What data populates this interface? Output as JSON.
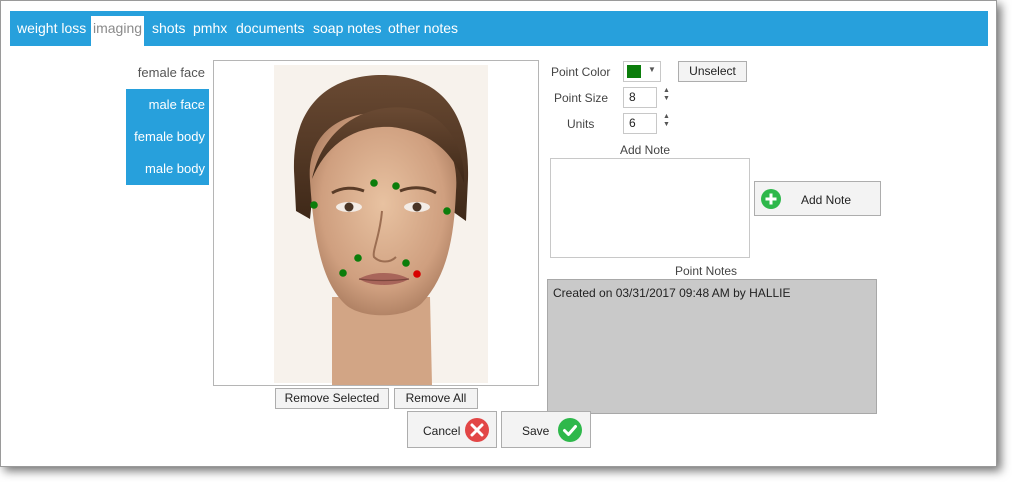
{
  "tabs": [
    {
      "label": "weight loss"
    },
    {
      "label": "imaging"
    },
    {
      "label": "shots"
    },
    {
      "label": "pmhx"
    },
    {
      "label": "documents"
    },
    {
      "label": "soap notes"
    },
    {
      "label": "other notes"
    }
  ],
  "active_tab": "imaging",
  "nav": {
    "items": [
      {
        "label": "female face"
      },
      {
        "label": "male face"
      },
      {
        "label": "female body"
      },
      {
        "label": "male body"
      }
    ]
  },
  "image": {
    "subject": "female face illustration",
    "point_colors": {
      "green": "#0b7d0b",
      "red": "#d80000"
    }
  },
  "image_actions": {
    "remove_selected": "Remove Selected",
    "remove_all": "Remove All"
  },
  "controls": {
    "point_color_label": "Point Color",
    "point_color_value": "#0b7d0b",
    "unselect": "Unselect",
    "point_size_label": "Point Size",
    "point_size_value": "8",
    "units_label": "Units",
    "units_value": "6",
    "add_note_label": "Add Note",
    "add_note_button": "Add Note",
    "point_notes_label": "Point Notes",
    "point_notes_text": "Created on 03/31/2017 09:48 AM by HALLIE"
  },
  "footer": {
    "cancel": "Cancel",
    "save": "Save"
  },
  "colors": {
    "accent": "#27a0dc",
    "cancel_icon": "#e24646",
    "save_icon": "#2eb84b",
    "add_icon": "#2eb84b"
  }
}
